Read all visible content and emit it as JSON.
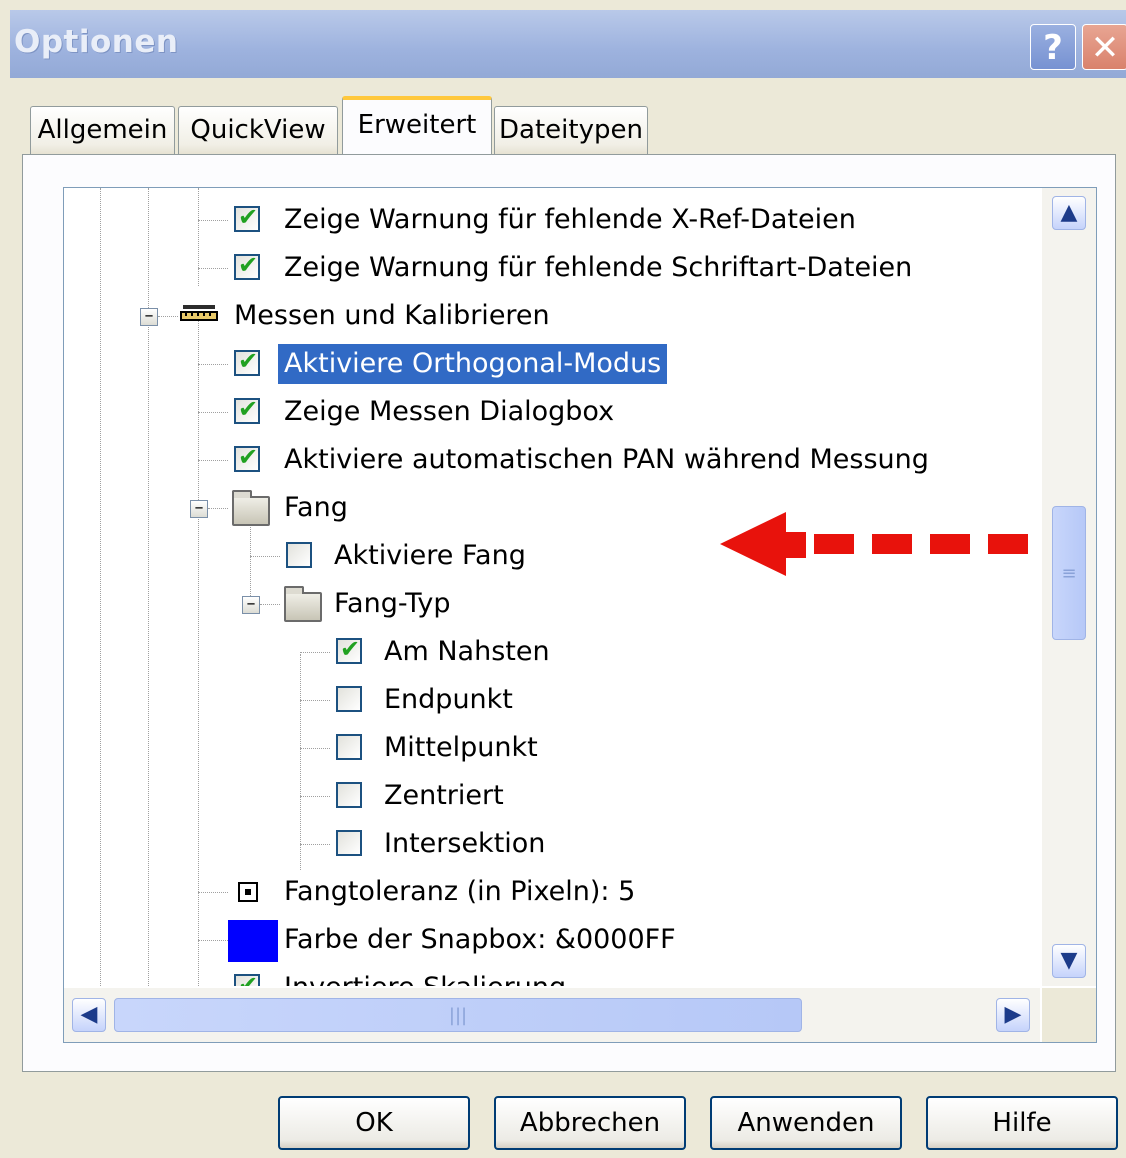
{
  "window": {
    "title": "Optionen",
    "help_glyph": "?",
    "close_glyph": "✕"
  },
  "tabs": [
    {
      "label": "Allgemein",
      "active": false
    },
    {
      "label": "QuickView",
      "active": false
    },
    {
      "label": "Erweitert",
      "active": true
    },
    {
      "label": "Dateitypen",
      "active": false
    }
  ],
  "tree": {
    "items": [
      {
        "label": "Zeige Warnung für fehlende X-Ref-Dateien",
        "checked": true
      },
      {
        "label": "Zeige Warnung für fehlende Schriftart-Dateien",
        "checked": true
      },
      {
        "label": "Messen und Kalibrieren",
        "icon": "ruler-icon",
        "expanded": true
      },
      {
        "label": "Aktiviere Orthogonal-Modus",
        "checked": true,
        "selected": true
      },
      {
        "label": "Zeige Messen Dialogbox",
        "checked": true
      },
      {
        "label": "Aktiviere automatischen PAN während Messung",
        "checked": true
      },
      {
        "label": "Fang",
        "icon": "folder-icon",
        "expanded": true
      },
      {
        "label": "Aktiviere Fang",
        "checked": false
      },
      {
        "label": "Fang-Typ",
        "icon": "folder-icon",
        "expanded": true
      },
      {
        "label": "Am Nahsten",
        "checked": true
      },
      {
        "label": "Endpunkt",
        "checked": false
      },
      {
        "label": "Mittelpunkt",
        "checked": false
      },
      {
        "label": "Zentriert",
        "checked": false
      },
      {
        "label": "Intersektion",
        "checked": false
      },
      {
        "label": "Fangtoleranz (in Pixeln): 5",
        "icon": "radio-icon"
      },
      {
        "label": "Farbe der Snapbox: &0000FF",
        "icon": "color-swatch",
        "color": "#0000ff"
      },
      {
        "label": "Invertiere Skalierung",
        "checked": true
      }
    ]
  },
  "scroll": {
    "up": "▲",
    "down": "▼",
    "left": "◀",
    "right": "▶",
    "grip_v": "≡",
    "grip_h": "|||"
  },
  "buttons": {
    "ok": "OK",
    "cancel": "Abbrechen",
    "apply": "Anwenden",
    "help": "Hilfe"
  },
  "colors": {
    "titlebar": "#9db2de",
    "selection": "#316ac5",
    "tab_highlight": "#ffc83c",
    "arrow": "#e8120c"
  }
}
